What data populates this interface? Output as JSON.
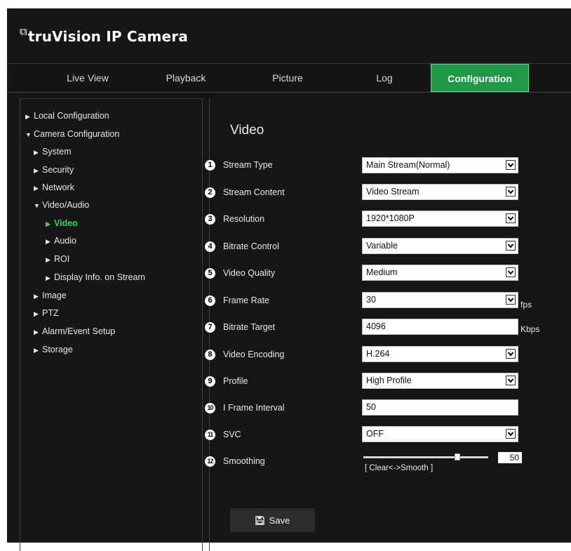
{
  "app": {
    "title": "truVision IP Camera"
  },
  "nav": {
    "tabs": [
      {
        "label": "Live View"
      },
      {
        "label": "Playback"
      },
      {
        "label": "Picture"
      },
      {
        "label": "Log"
      },
      {
        "label": "Configuration",
        "active": true
      }
    ]
  },
  "sidebar": {
    "items": [
      {
        "label": "Local Configuration",
        "arrow": "▶"
      },
      {
        "label": "Camera Configuration",
        "arrow": "▼"
      },
      {
        "label": "System",
        "arrow": "▶"
      },
      {
        "label": "Security",
        "arrow": "▶"
      },
      {
        "label": "Network",
        "arrow": "▶"
      },
      {
        "label": "Video/Audio",
        "arrow": "▼"
      },
      {
        "label": "Video",
        "arrow": "▶",
        "active": true
      },
      {
        "label": "Audio",
        "arrow": "▶"
      },
      {
        "label": "ROI",
        "arrow": "▶"
      },
      {
        "label": "Display Info. on Stream",
        "arrow": "▶"
      },
      {
        "label": "Image",
        "arrow": "▶"
      },
      {
        "label": "PTZ",
        "arrow": "▶"
      },
      {
        "label": "Alarm/Event Setup",
        "arrow": "▶"
      },
      {
        "label": "Storage",
        "arrow": "▶"
      }
    ]
  },
  "main": {
    "title": "Video",
    "fields": [
      {
        "num": "1",
        "label": "Stream Type",
        "type": "select",
        "value": "Main Stream(Normal)"
      },
      {
        "num": "2",
        "label": "Stream Content",
        "type": "select",
        "value": "Video Stream"
      },
      {
        "num": "3",
        "label": "Resolution",
        "type": "select",
        "value": "1920*1080P"
      },
      {
        "num": "4",
        "label": "Bitrate Control",
        "type": "select",
        "value": "Variable"
      },
      {
        "num": "5",
        "label": "Video Quality",
        "type": "select",
        "value": "Medium"
      },
      {
        "num": "6",
        "label": "Frame Rate",
        "type": "select",
        "value": "30",
        "unit": "fps"
      },
      {
        "num": "7",
        "label": "Bitrate Target",
        "type": "input",
        "value": "4096",
        "unit": "Kbps"
      },
      {
        "num": "8",
        "label": "Video Encoding",
        "type": "select",
        "value": "H.264"
      },
      {
        "num": "9",
        "label": "Profile",
        "type": "select",
        "value": "High Profile"
      },
      {
        "num": "10",
        "label": "I Frame Interval",
        "type": "input",
        "value": "50"
      },
      {
        "num": "11",
        "label": "SVC",
        "type": "select",
        "value": "OFF"
      }
    ],
    "smoothing": {
      "num": "12",
      "label": "Smoothing",
      "value": "50",
      "level": 0.5,
      "caption": "[ Clear<->Smooth ]"
    },
    "save_label": "Save"
  },
  "colors": {
    "accent": "#1e9a47",
    "active_text": "#2bd46a",
    "background": "#161616"
  },
  "icons": {
    "save": "floppy-disk-icon",
    "dropdown": "chevron-down-icon",
    "tree": "triangle-icon"
  }
}
